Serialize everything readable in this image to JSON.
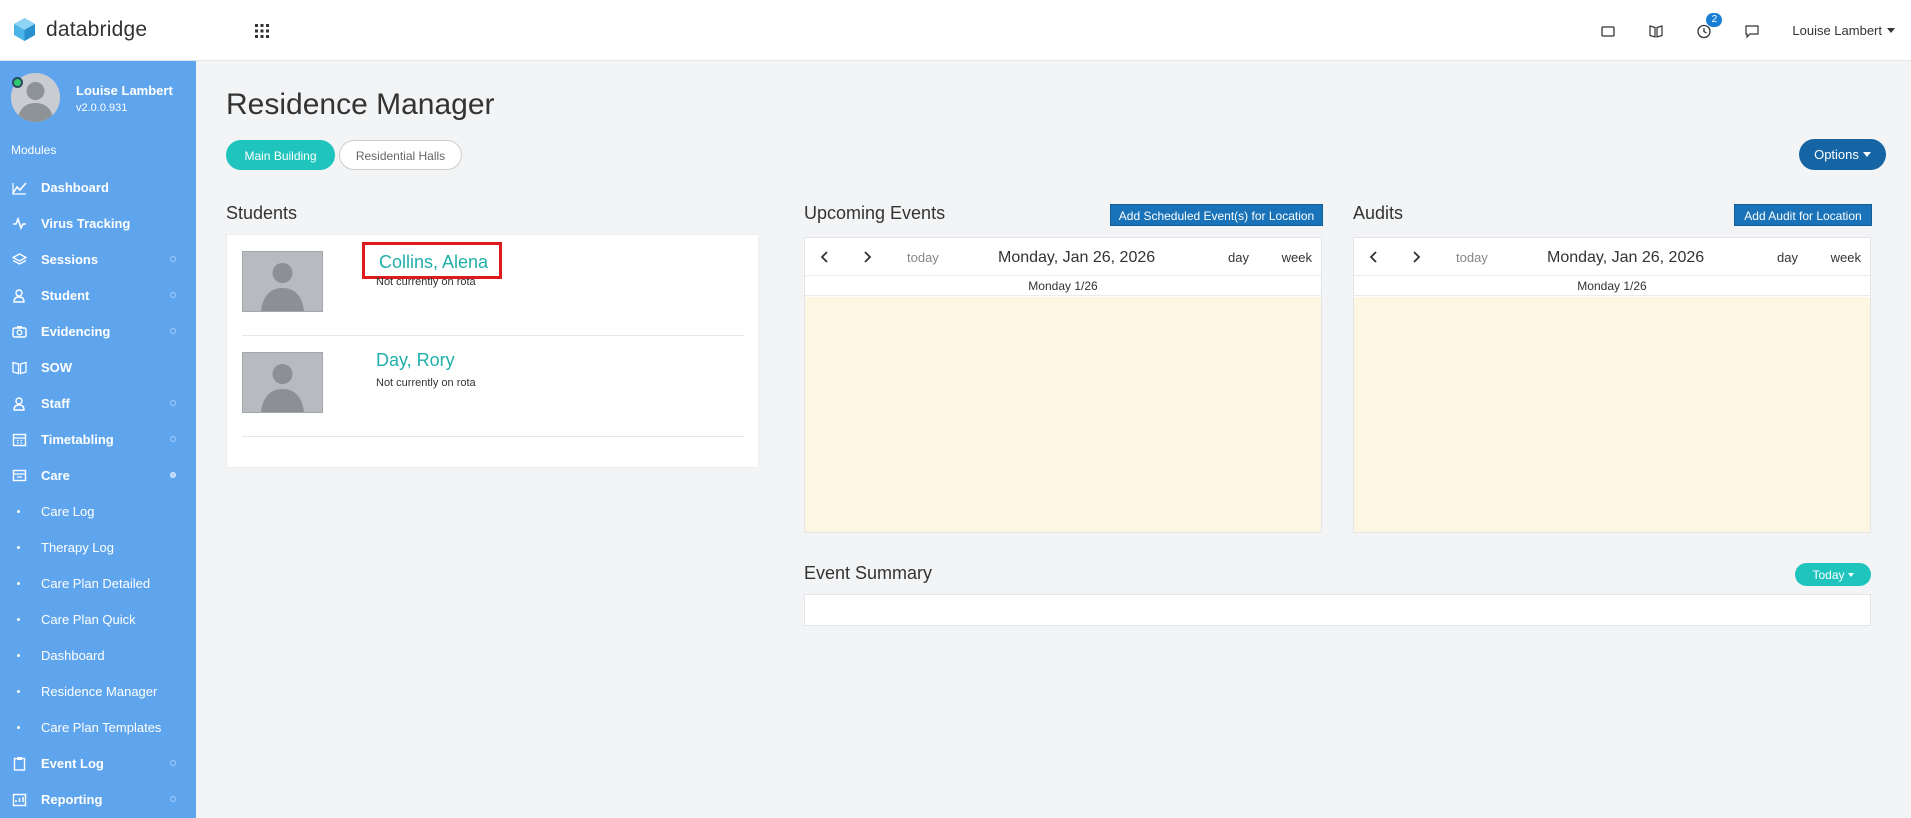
{
  "brand": {
    "name": "databridge"
  },
  "topbar": {
    "notification_count": "2",
    "user_name": "Louise Lambert",
    "icons": [
      "tablet-icon",
      "book-icon",
      "clock-icon",
      "chat-icon"
    ]
  },
  "sidebar": {
    "profile_name": "Louise Lambert",
    "version": "v2.0.0.931",
    "modules_label": "Modules",
    "items": [
      {
        "label": "Dashboard",
        "icon": "chart-line-icon"
      },
      {
        "label": "Virus Tracking",
        "icon": "pulse-icon"
      },
      {
        "label": "Sessions",
        "icon": "layers-icon"
      },
      {
        "label": "Student",
        "icon": "student-icon"
      },
      {
        "label": "Evidencing",
        "icon": "camera-icon"
      },
      {
        "label": "SOW",
        "icon": "book-icon"
      },
      {
        "label": "Staff",
        "icon": "staff-icon"
      },
      {
        "label": "Timetabling",
        "icon": "calendar-icon"
      },
      {
        "label": "Care",
        "icon": "care-icon"
      },
      {
        "label": "Event Log",
        "icon": "clipboard-icon"
      },
      {
        "label": "Reporting",
        "icon": "report-icon"
      }
    ],
    "care_subitems": [
      {
        "label": "Care Log"
      },
      {
        "label": "Therapy Log"
      },
      {
        "label": "Care Plan Detailed"
      },
      {
        "label": "Care Plan Quick"
      },
      {
        "label": "Dashboard"
      },
      {
        "label": "Residence Manager"
      },
      {
        "label": "Care Plan Templates"
      }
    ]
  },
  "main": {
    "title": "Residence Manager",
    "location_tabs": [
      {
        "label": "Main Building",
        "active": true
      },
      {
        "label": "Residential Halls",
        "active": false
      }
    ],
    "options_label": "Options",
    "students": {
      "title": "Students",
      "list": [
        {
          "name": "Collins, Alena",
          "status": "Not currently on rota"
        },
        {
          "name": "Day, Rory",
          "status": "Not currently on rota"
        }
      ]
    },
    "upcoming_events": {
      "title": "Upcoming Events",
      "add_label": "Add Scheduled Event(s) for Location",
      "today_label": "today",
      "date_label": "Monday, Jan 26, 2026",
      "day_label": "day",
      "week_label": "week",
      "column_header": "Monday 1/26"
    },
    "audits": {
      "title": "Audits",
      "add_label": "Add Audit for Location",
      "today_label": "today",
      "date_label": "Monday, Jan 26, 2026",
      "day_label": "day",
      "week_label": "week",
      "column_header": "Monday 1/26"
    },
    "event_summary": {
      "title": "Event Summary",
      "filter_label": "Today"
    }
  },
  "colors": {
    "sidebar_bg": "#5ea5ee",
    "accent_teal": "#1fc4bd",
    "primary_blue": "#1565a5",
    "calendar_today_bg": "#fdf6e2",
    "highlight_red": "#e0191f"
  }
}
